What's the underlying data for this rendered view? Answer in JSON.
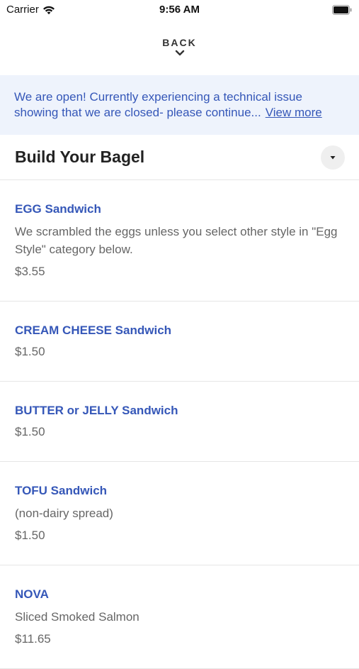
{
  "status_bar": {
    "carrier": "Carrier",
    "time": "9:56 AM",
    "wifi_icon": "wifi-icon",
    "battery_icon": "battery-icon"
  },
  "nav": {
    "back_label": "BACK",
    "back_icon": "chevron-down-icon"
  },
  "banner": {
    "message": "We are open! Currently experiencing a technical issue showing that we are closed- please continue...",
    "link_label": "View more"
  },
  "section": {
    "title": "Build Your Bagel",
    "toggle_icon": "caret-down-icon"
  },
  "items": [
    {
      "name": "EGG Sandwich",
      "description": "We scrambled the eggs unless you select other style in \"Egg Style\" category below.",
      "price": "$3.55"
    },
    {
      "name": "CREAM CHEESE Sandwich",
      "price": "$1.50"
    },
    {
      "name": "BUTTER or JELLY Sandwich",
      "price": "$1.50"
    },
    {
      "name": "TOFU Sandwich",
      "description": "(non-dairy spread)",
      "price": "$1.50"
    },
    {
      "name": "NOVA",
      "description": "Sliced Smoked Salmon",
      "price": "$11.65"
    }
  ],
  "colors": {
    "accent": "#3557b8",
    "banner_bg": "#eef3fc",
    "muted_text": "#666666"
  }
}
